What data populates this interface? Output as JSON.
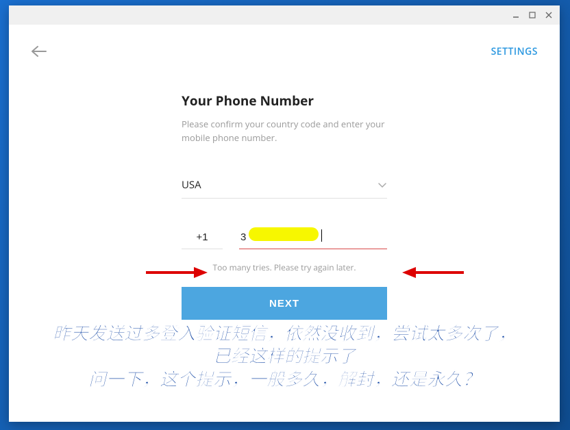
{
  "header": {
    "settings_label": "SETTINGS"
  },
  "form": {
    "heading": "Your Phone Number",
    "subtext": "Please confirm your country code and enter your mobile phone number.",
    "country": "USA",
    "code_value": "+1",
    "phone_value": "3",
    "error": "Too many tries. Please try again later.",
    "next_label": "NEXT"
  },
  "annotation": {
    "line1": "昨天发送过多登入验证短信，依然没收到，尝试太多次了，",
    "line2": "已经这样的提示了",
    "line3": "问一下，这个提示，一般多久，解封，还是永久？"
  }
}
